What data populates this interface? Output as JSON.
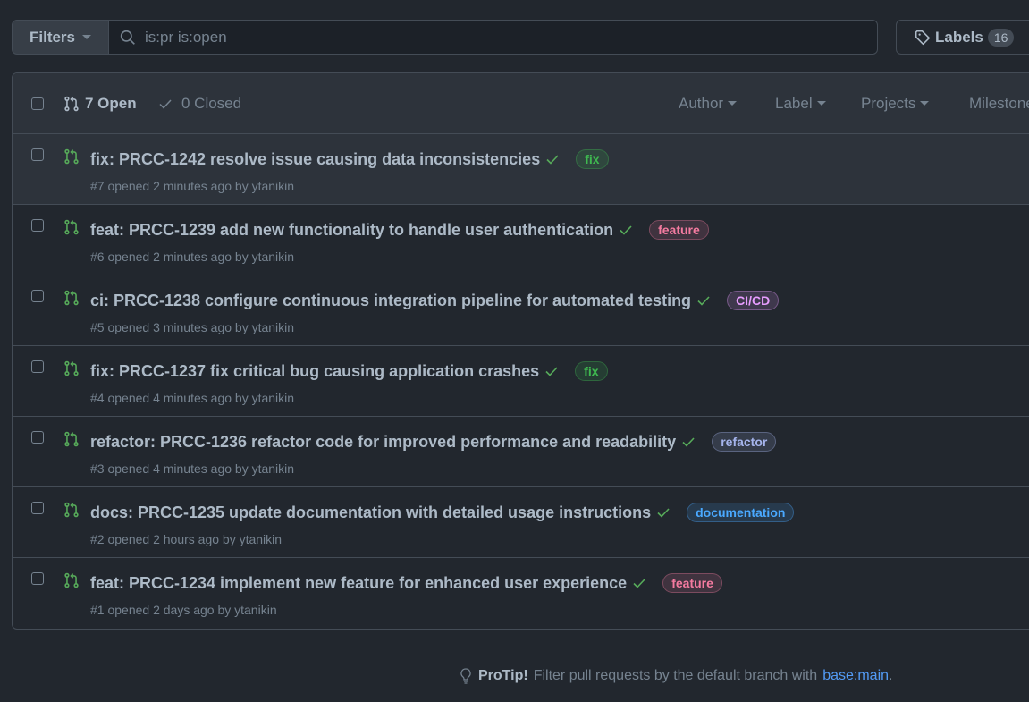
{
  "toolbar": {
    "filters_label": "Filters",
    "search_value": "is:pr is:open",
    "labels_label": "Labels",
    "labels_count": "16"
  },
  "list_header": {
    "open_label": "7 Open",
    "closed_label": "0 Closed",
    "filters": [
      "Author",
      "Label",
      "Projects",
      "Milestones"
    ]
  },
  "pull_requests": [
    {
      "title": "fix: PRCC-1242 resolve issue causing data inconsistencies",
      "label": "fix",
      "label_color": "#3fb950",
      "meta": "#7 opened 2 minutes ago by ytanikin"
    },
    {
      "title": "feat: PRCC-1239 add new functionality to handle user authentication",
      "label": "feature",
      "label_color": "#f47ba0",
      "meta": "#6 opened 2 minutes ago by ytanikin"
    },
    {
      "title": "ci: PRCC-1238 configure continuous integration pipeline for automated testing",
      "label": "CI/CD",
      "label_color": "#e89dff",
      "meta": "#5 opened 3 minutes ago by ytanikin"
    },
    {
      "title": "fix: PRCC-1237 fix critical bug causing application crashes",
      "label": "fix",
      "label_color": "#3fb950",
      "meta": "#4 opened 4 minutes ago by ytanikin"
    },
    {
      "title": "refactor: PRCC-1236 refactor code for improved performance and readability",
      "label": "refactor",
      "label_color": "#a5b4ec",
      "meta": "#3 opened 4 minutes ago by ytanikin"
    },
    {
      "title": "docs: PRCC-1235 update documentation with detailed usage instructions",
      "label": "documentation",
      "label_color": "#4aa9ff",
      "meta": "#2 opened 2 hours ago by ytanikin"
    },
    {
      "title": "feat: PRCC-1234 implement new feature for enhanced user experience",
      "label": "feature",
      "label_color": "#f47ba0",
      "meta": "#1 opened 2 days ago by ytanikin"
    }
  ],
  "protip": {
    "bold": "ProTip!",
    "text": "Filter pull requests by the default branch with",
    "link": "base:main",
    "end": "."
  }
}
